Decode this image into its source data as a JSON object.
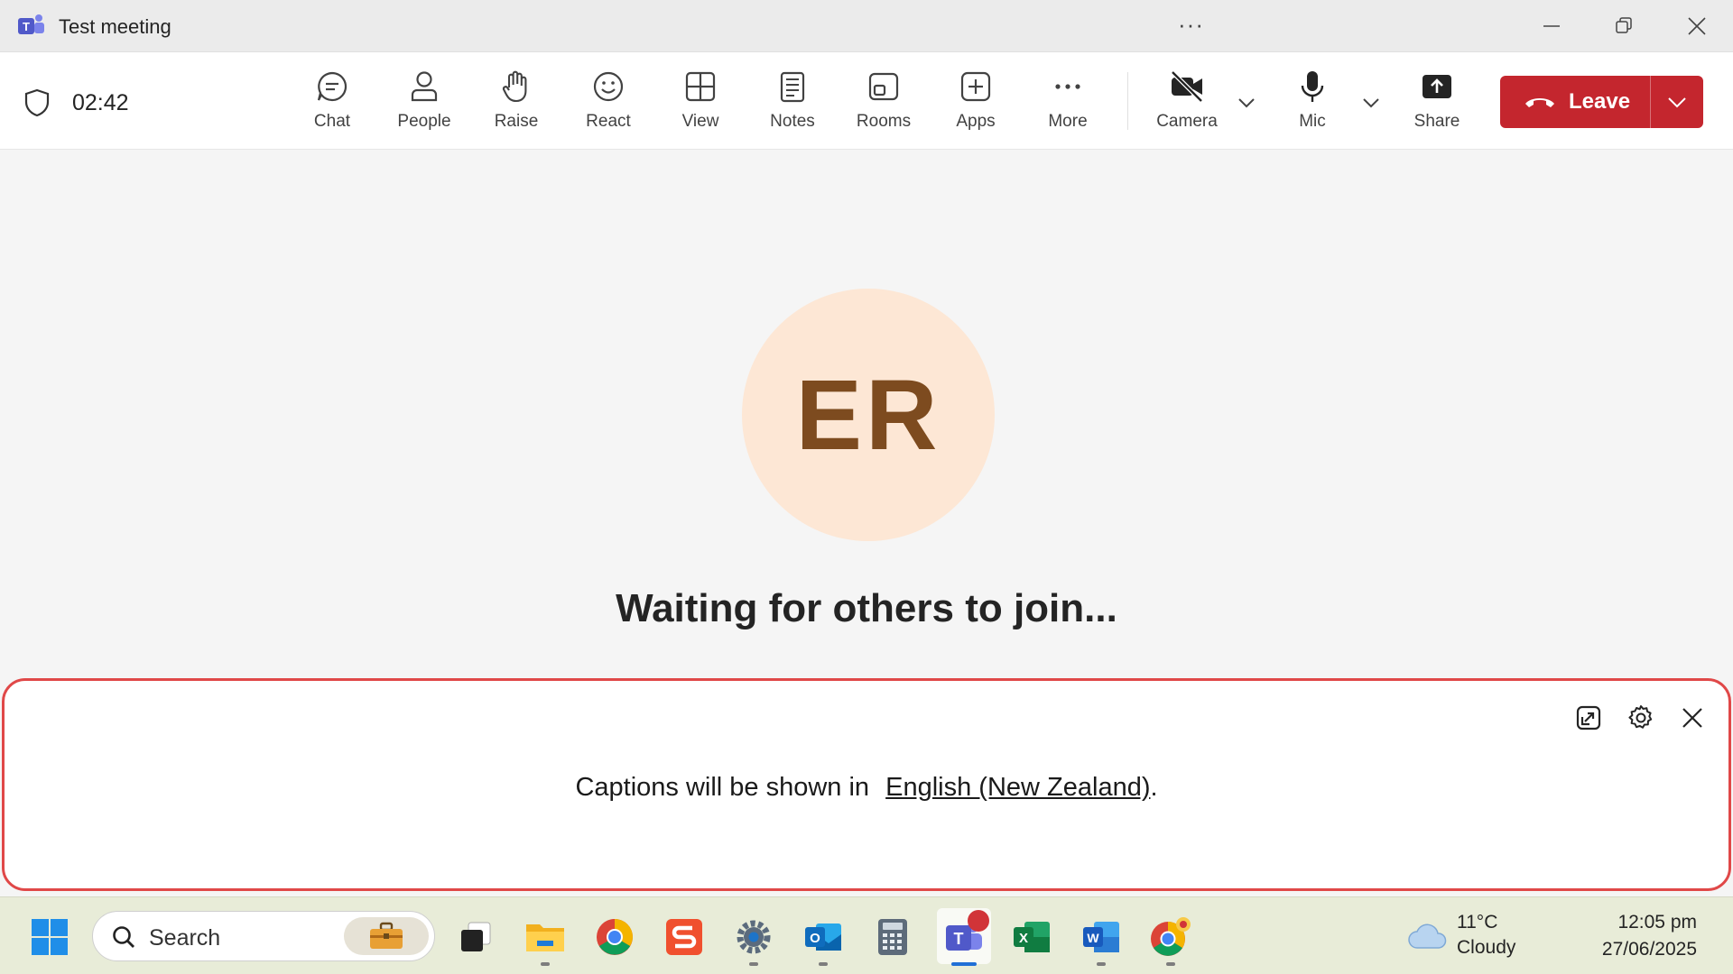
{
  "window": {
    "title": "Test meeting",
    "more_label": "···"
  },
  "toolbar": {
    "timer": "02:42",
    "buttons": [
      {
        "label": "Chat",
        "icon": "chat-icon"
      },
      {
        "label": "People",
        "icon": "people-icon"
      },
      {
        "label": "Raise",
        "icon": "raise-hand-icon"
      },
      {
        "label": "React",
        "icon": "smiley-icon"
      },
      {
        "label": "View",
        "icon": "grid-view-icon"
      },
      {
        "label": "Notes",
        "icon": "notes-icon"
      },
      {
        "label": "Rooms",
        "icon": "rooms-icon"
      },
      {
        "label": "Apps",
        "icon": "add-app-icon"
      },
      {
        "label": "More",
        "icon": "more-dots-icon"
      },
      {
        "label": "Camera",
        "icon": "camera-off-icon"
      },
      {
        "label": "Mic",
        "icon": "mic-icon"
      },
      {
        "label": "Share",
        "icon": "share-icon"
      }
    ],
    "leave_label": "Leave",
    "leave_color": "#c4262e"
  },
  "stage": {
    "avatar_initials": "ER",
    "avatar_bg": "#fde7d5",
    "status_text": "Waiting for others to join..."
  },
  "captions": {
    "text_prefix": "Captions will be shown in",
    "language_link": "English (New Zealand)",
    "text_suffix": ".",
    "highlight_color": "#e04848"
  },
  "taskbar": {
    "search_placeholder": "Search",
    "apps": [
      {
        "name": "task-view",
        "icon": "task-view-icon"
      },
      {
        "name": "file-explorer",
        "icon": "folder-icon"
      },
      {
        "name": "chrome",
        "icon": "chrome-icon"
      },
      {
        "name": "slack-s",
        "icon": "s-app-icon"
      },
      {
        "name": "settings",
        "icon": "settings-icon"
      },
      {
        "name": "outlook",
        "icon": "outlook-icon"
      },
      {
        "name": "calculator",
        "icon": "calculator-icon"
      },
      {
        "name": "teams",
        "icon": "teams-icon"
      },
      {
        "name": "excel",
        "icon": "excel-icon"
      },
      {
        "name": "word",
        "icon": "word-icon"
      },
      {
        "name": "chrome-profile",
        "icon": "chrome-profile-icon"
      }
    ],
    "weather": {
      "temp": "11°C",
      "condition": "Cloudy"
    },
    "clock": {
      "time": "12:05 pm",
      "date": "27/06/2025"
    }
  }
}
